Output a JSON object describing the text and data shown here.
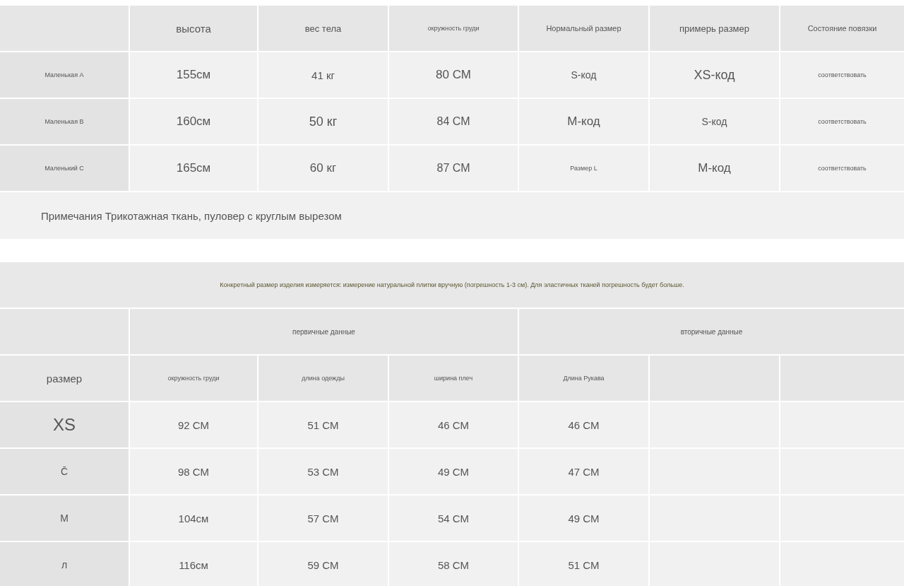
{
  "size_table": {
    "columns": [
      "высота",
      "вес тела",
      "окружность груди",
      "Нормальный размер",
      "примерь размер",
      "Состояние повязки"
    ],
    "rows": [
      {
        "label": "Маленькая A",
        "cells": [
          "155см",
          "41 кг",
          "80 СМ",
          "S-код",
          "XS-код",
          "соответствовать"
        ]
      },
      {
        "label": "Маленькая B",
        "cells": [
          "160см",
          "50 кг",
          "84 СМ",
          "M-код",
          "S-код",
          "соответствовать"
        ]
      },
      {
        "label": "Маленький C",
        "cells": [
          "165см",
          "60 кг",
          "87 СМ",
          "Размер L",
          "M-код",
          "соответствовать"
        ]
      }
    ],
    "note": "Примечания Трикотажная ткань, пуловер с круглым вырезом"
  },
  "banner": "Конкретный размер изделия измеряется: измерение натуральной плитки вручную (погрешность 1-3 см). Для эластичных тканей погрешность будет больше.",
  "measure_table": {
    "groups": [
      "первичные данные",
      "вторичные данные"
    ],
    "size_header": "размер",
    "columns": [
      "окружность груди",
      "длина одежды",
      "ширина плеч",
      "Длина Рукава"
    ],
    "rows": [
      {
        "size": "XS",
        "cells": [
          "92 СМ",
          "51 СМ",
          "46 СМ",
          "46 СМ"
        ]
      },
      {
        "size": "C̄",
        "cells": [
          "98 СМ",
          "53 СМ",
          "49 СМ",
          "47 СМ"
        ]
      },
      {
        "size": "М",
        "cells": [
          "104см",
          "57 СМ",
          "54 СМ",
          "49 СМ"
        ]
      },
      {
        "size": "л",
        "cells": [
          "116см",
          "59 СМ",
          "58 СМ",
          "51 СМ"
        ]
      }
    ]
  }
}
